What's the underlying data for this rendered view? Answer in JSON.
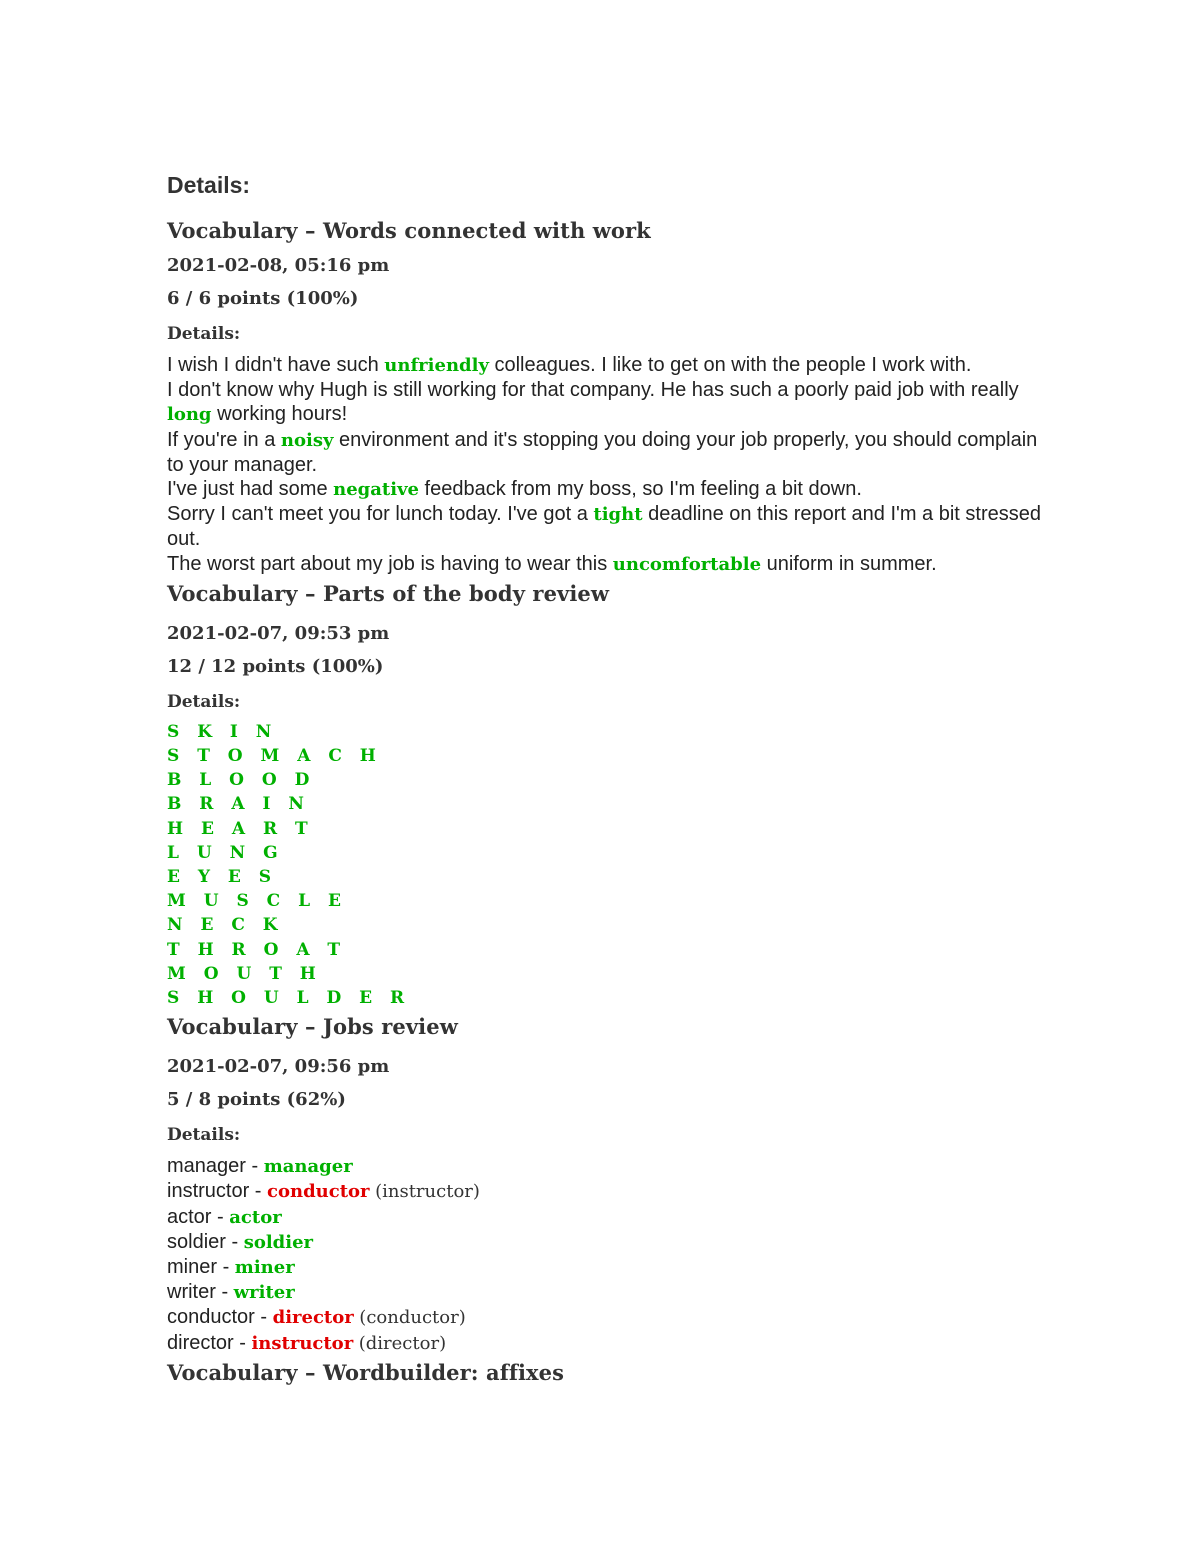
{
  "top_heading": "Details:",
  "colors": {
    "correct": "#00b000",
    "incorrect": "#e00000",
    "text": "#222222",
    "heading": "#333333"
  },
  "sections": [
    {
      "title": "Vocabulary – Words connected with work",
      "date": "2021-02-08, 05:16 pm",
      "points": "6 / 6 points (100%)",
      "details_label": "Details:",
      "sentences": [
        {
          "before": "I wish I didn't have such ",
          "answer": "unfriendly",
          "after": " colleagues. I like to get on with the people I work with."
        },
        {
          "before": "I don't know why Hugh is still working for that company. He has such a poorly paid job with really ",
          "answer": "long",
          "after": " working hours!"
        },
        {
          "before": "If you're in a ",
          "answer": "noisy",
          "after": " environment and it's stopping you doing your job properly, you should complain to your manager."
        },
        {
          "before": "I've just had some ",
          "answer": "negative",
          "after": " feedback from my boss, so I'm feeling a bit down."
        },
        {
          "before": "Sorry I can't meet you for lunch today. I've got a ",
          "answer": "tight",
          "after": " deadline on this report and I'm a bit stressed out."
        },
        {
          "before": "The worst part about my job is having to wear this ",
          "answer": "uncomfortable",
          "after": " uniform in summer."
        }
      ]
    },
    {
      "title": "Vocabulary – Parts of the body review",
      "date": "2021-02-07, 09:53 pm",
      "points": "12 / 12 points (100%)",
      "details_label": "Details:",
      "words": [
        "S K I N",
        "S T O M A C H",
        "B L O O D",
        "B R A I N",
        "H E A R T",
        "L U N G",
        "E Y E S",
        "M U S C L E",
        "N E C K",
        "T H R O A T",
        "M O U T H",
        "S H O U L D E R"
      ]
    },
    {
      "title": "Vocabulary – Jobs review",
      "date": "2021-02-07, 09:56 pm",
      "points": "5 / 8 points (62%)",
      "details_label": "Details:",
      "answers": [
        {
          "prompt": "manager - ",
          "given": "manager",
          "correct": true,
          "expected": ""
        },
        {
          "prompt": "instructor - ",
          "given": "conductor",
          "correct": false,
          "expected": "(instructor)"
        },
        {
          "prompt": "actor - ",
          "given": "actor",
          "correct": true,
          "expected": ""
        },
        {
          "prompt": "soldier - ",
          "given": "soldier",
          "correct": true,
          "expected": ""
        },
        {
          "prompt": "miner - ",
          "given": "miner",
          "correct": true,
          "expected": ""
        },
        {
          "prompt": "writer - ",
          "given": "writer",
          "correct": true,
          "expected": ""
        },
        {
          "prompt": "conductor - ",
          "given": "director",
          "correct": false,
          "expected": "(conductor)"
        },
        {
          "prompt": "director - ",
          "given": "instructor",
          "correct": false,
          "expected": "(director)"
        }
      ]
    },
    {
      "title": "Vocabulary – Wordbuilder: affixes"
    }
  ]
}
